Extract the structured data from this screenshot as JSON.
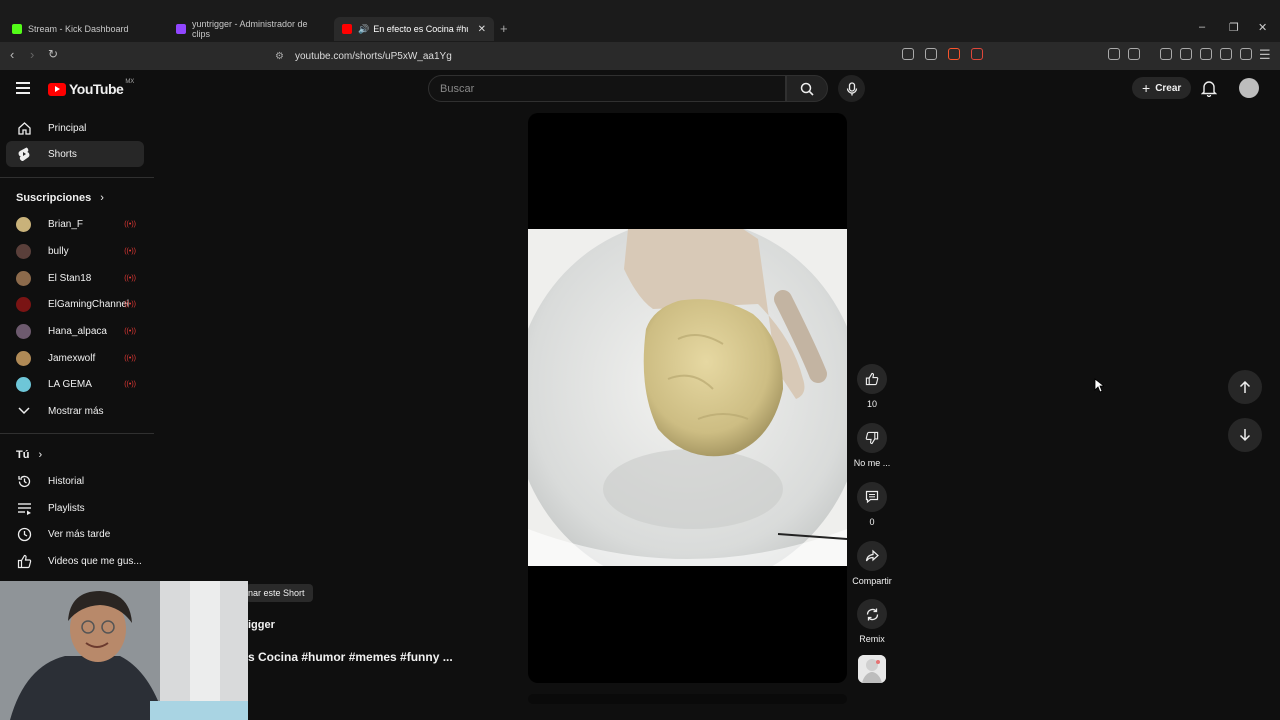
{
  "browser": {
    "tabs": [
      {
        "title": "Stream - Kick Dashboard",
        "favicon_color": "#53fc18"
      },
      {
        "title": "yuntrigger - Administrador de clips",
        "favicon_color": "#9146ff"
      },
      {
        "title": "En efecto es Cocina #humor",
        "favicon_color": "#ff0000"
      }
    ],
    "new_tab": "+",
    "url": "youtube.com/shorts/uP5xW_aa1Yg",
    "window_controls": [
      "–",
      "❐",
      "✕"
    ]
  },
  "header": {
    "logo_text": "YouTube",
    "country": "MX",
    "search_placeholder": "Buscar",
    "create_label": "Crear"
  },
  "sidebar": {
    "main": [
      {
        "label": "Principal",
        "icon": "home-icon"
      },
      {
        "label": "Shorts",
        "icon": "shorts-icon"
      }
    ],
    "subscriptions_title": "Suscripciones",
    "subscriptions": [
      {
        "label": "Brian_F",
        "color": "#c9b27a"
      },
      {
        "label": "bully",
        "color": "#5a3f3a"
      },
      {
        "label": "El Stan18",
        "color": "#8c6a4b"
      },
      {
        "label": "ElGamingChannel",
        "color": "#7a1414"
      },
      {
        "label": "Hana_alpaca",
        "color": "#6d5a6e"
      },
      {
        "label": "Jamexwolf",
        "color": "#b08a56"
      },
      {
        "label": "LA GEMA",
        "color": "#6ec6d8"
      }
    ],
    "live_marker": "((•))",
    "show_more": "Mostrar más",
    "you_title": "Tú",
    "you_items": [
      {
        "label": "Historial",
        "icon": "history-icon"
      },
      {
        "label": "Playlists",
        "icon": "playlists-icon"
      },
      {
        "label": "Ver más tarde",
        "icon": "watch-later-icon"
      },
      {
        "label": "Videos que me gus...",
        "icon": "liked-videos-icon"
      }
    ]
  },
  "short": {
    "likes": "10",
    "dislike_label": "No me ...",
    "comments": "0",
    "share_label": "Compartir",
    "remix_label": "Remix",
    "chip_text": "nar este Short",
    "channel": "igger",
    "title": "s Cocina #humor #memes #funny ..."
  }
}
